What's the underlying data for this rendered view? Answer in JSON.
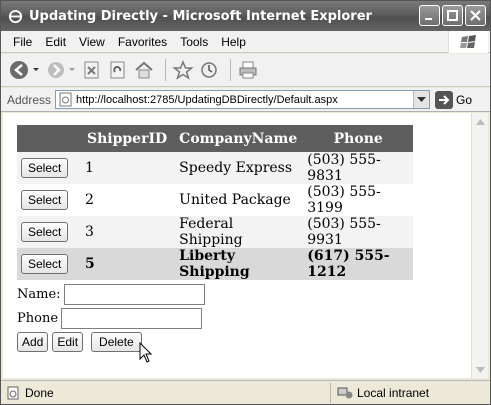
{
  "window": {
    "title": "Updating Directly - Microsoft Internet Explorer"
  },
  "menu": [
    "File",
    "Edit",
    "View",
    "Favorites",
    "Tools",
    "Help"
  ],
  "address": {
    "label": "Address",
    "url": "http://localhost:2785/UpdatingDBDirectly/Default.aspx",
    "go_label": "Go"
  },
  "grid": {
    "headers": [
      "",
      "ShipperID",
      "CompanyName",
      "Phone"
    ],
    "select_label": "Select",
    "rows": [
      {
        "id": "1",
        "company": "Speedy Express",
        "phone": "(503) 555-9831"
      },
      {
        "id": "2",
        "company": "United Package",
        "phone": "(503) 555-3199"
      },
      {
        "id": "3",
        "company": "Federal Shipping",
        "phone": "(503) 555-9931"
      },
      {
        "id": "5",
        "company": "Liberty Shipping",
        "phone": "(617) 555-1212"
      }
    ],
    "selected_index": 3
  },
  "form": {
    "name_label": "Name:",
    "phone_label": "Phone",
    "name_value": "",
    "phone_value": "",
    "add_label": "Add",
    "edit_label": "Edit",
    "delete_label": "Delete"
  },
  "status": {
    "text": "Done",
    "zone": "Local intranet"
  },
  "icons": {
    "title": "ie-icon",
    "back": "back-arrow-icon",
    "forward": "forward-arrow-icon",
    "stop": "stop-icon",
    "refresh": "refresh-icon",
    "home": "home-icon",
    "favorites": "star-icon",
    "history": "history-icon",
    "print": "print-icon"
  }
}
